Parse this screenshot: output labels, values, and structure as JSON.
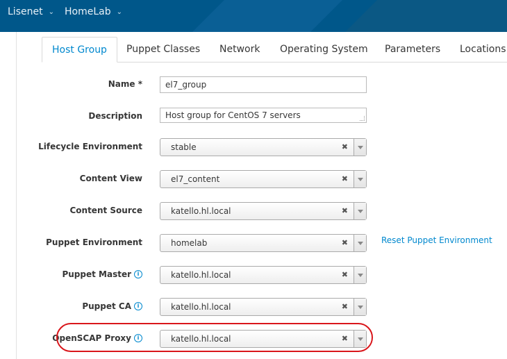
{
  "topbar": {
    "org_menu": "Lisenet",
    "location_menu": "HomeLab"
  },
  "tabs": [
    {
      "label": "Host Group",
      "active": true
    },
    {
      "label": "Puppet Classes",
      "active": false
    },
    {
      "label": "Network",
      "active": false
    },
    {
      "label": "Operating System",
      "active": false
    },
    {
      "label": "Parameters",
      "active": false
    },
    {
      "label": "Locations",
      "active": false
    }
  ],
  "form": {
    "name": {
      "label": "Name *",
      "value": "el7_group"
    },
    "description": {
      "label": "Description",
      "value": "Host group for CentOS 7 servers"
    },
    "lifecycle_environment": {
      "label": "Lifecycle Environment",
      "value": "stable"
    },
    "content_view": {
      "label": "Content View",
      "value": "el7_content"
    },
    "content_source": {
      "label": "Content Source",
      "value": "katello.hl.local"
    },
    "puppet_environment": {
      "label": "Puppet Environment",
      "value": "homelab",
      "reset_link": "Reset Puppet Environment"
    },
    "puppet_master": {
      "label": "Puppet Master",
      "value": "katello.hl.local"
    },
    "puppet_ca": {
      "label": "Puppet CA",
      "value": "katello.hl.local"
    },
    "openscap_proxy": {
      "label": "OpenSCAP Proxy",
      "value": "katello.hl.local"
    }
  },
  "glyphs": {
    "clear": "✖",
    "chevron": "⌄",
    "help": "i"
  },
  "colors": {
    "topbar": "#00578a",
    "accent": "#0088ce",
    "highlight": "#d9161b"
  }
}
